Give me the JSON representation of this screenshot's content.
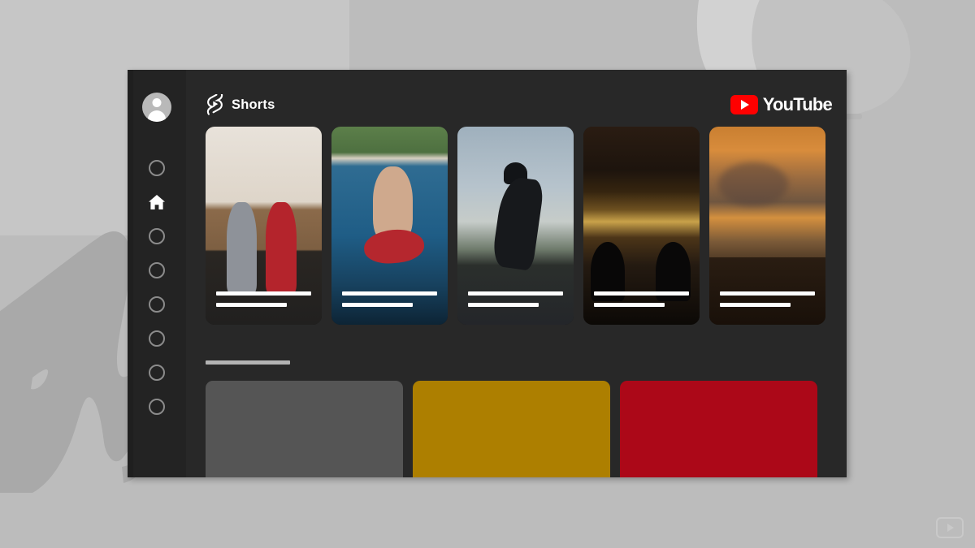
{
  "slide": {
    "background_color": "#bcbcbc",
    "decor_color": "#c6c6c6",
    "watermark_icon": "youtube-play-icon"
  },
  "app_window": {
    "background_color": "#282828",
    "sidebar": {
      "background_color": "#232323",
      "avatar": {
        "icon": "user-avatar-icon"
      },
      "items": [
        {
          "icon": "placeholder-circle-icon",
          "active": false
        },
        {
          "icon": "home-icon",
          "active": true
        },
        {
          "icon": "placeholder-circle-icon",
          "active": false
        },
        {
          "icon": "placeholder-circle-icon",
          "active": false
        },
        {
          "icon": "placeholder-circle-icon",
          "active": false
        },
        {
          "icon": "placeholder-circle-icon",
          "active": false
        },
        {
          "icon": "placeholder-circle-icon",
          "active": false
        },
        {
          "icon": "placeholder-circle-icon",
          "active": false
        }
      ]
    },
    "header": {
      "shorts_icon": "youtube-shorts-icon",
      "shorts_label": "Shorts",
      "logo_icon": "youtube-play-icon",
      "logo_text": "YouTube",
      "logo_color": "#ff0000"
    },
    "shorts_shelf": {
      "items": [
        {
          "art": "thumb-dance",
          "alt": "two-people-dancing-indoors"
        },
        {
          "art": "thumb-water",
          "alt": "people-on-towable-tube-in-lake"
        },
        {
          "art": "thumb-skate",
          "alt": "person-skateboarding-at-dusk"
        },
        {
          "art": "thumb-concert",
          "alt": "crowd-at-indoor-concert"
        },
        {
          "art": "thumb-sunset",
          "alt": "orange-sunset-clouds-over-trees"
        }
      ]
    },
    "section": {
      "title_placeholder_color": "#b3b3b3",
      "cards": [
        {
          "color": "#555555",
          "name": "gray-card"
        },
        {
          "color": "#ad7f00",
          "name": "gold-card"
        },
        {
          "color": "#ac0818",
          "name": "red-card"
        }
      ]
    }
  }
}
